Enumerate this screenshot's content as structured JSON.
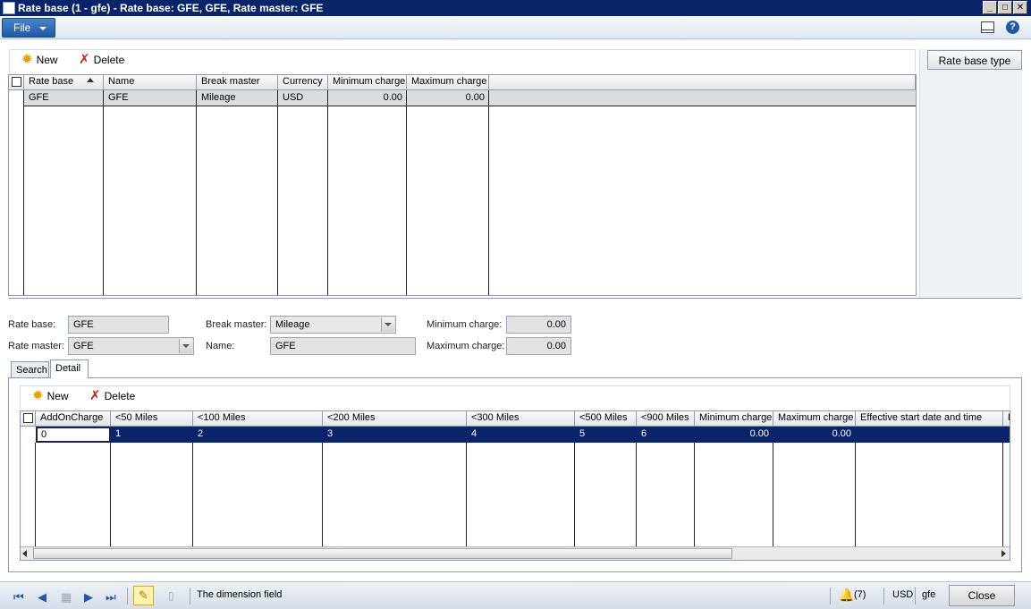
{
  "window": {
    "title": "Rate base (1 - gfe) - Rate base: GFE, GFE, Rate master: GFE",
    "controls": {
      "minimize": "_",
      "maximize": "□",
      "close": "✕"
    }
  },
  "menu": {
    "file_label": "File",
    "help_glyph": "?"
  },
  "top_toolbar": {
    "new_label": "New",
    "delete_label": "Delete",
    "side_button": "Rate base type"
  },
  "rate_grid": {
    "columns": [
      "Rate base",
      "Name",
      "Break master",
      "Currency",
      "Minimum charge",
      "Maximum charge"
    ],
    "rows": [
      {
        "rate_base": "GFE",
        "name": "GFE",
        "break_master": "Mileage",
        "currency": "USD",
        "min_charge": "0.00",
        "max_charge": "0.00"
      }
    ]
  },
  "form": {
    "rate_base_label": "Rate base:",
    "rate_base_value": "GFE",
    "rate_master_label": "Rate master:",
    "rate_master_value": "GFE",
    "break_master_label": "Break master:",
    "break_master_value": "Mileage",
    "name_label": "Name:",
    "name_value": "GFE",
    "min_charge_label": "Minimum charge:",
    "min_charge_value": "0.00",
    "max_charge_label": "Maximum charge:",
    "max_charge_value": "0.00"
  },
  "tabs": [
    "Search",
    "Detail"
  ],
  "detail_toolbar": {
    "new_label": "New",
    "delete_label": "Delete"
  },
  "detail_grid": {
    "columns": [
      "AddOnCharge",
      "<50 Miles",
      "<100 Miles",
      "<200 Miles",
      "<300 Miles",
      "<500 Miles",
      "<900 Miles",
      "Minimum charge",
      "Maximum charge",
      "Effective start date and time",
      "E"
    ],
    "row": [
      "0",
      "1",
      "2",
      "3",
      "4",
      "5",
      "6",
      "0.00",
      "0.00",
      ""
    ]
  },
  "status": {
    "message": "The dimension field",
    "notifications": "(7)",
    "currency": "USD",
    "company": "gfe",
    "close_label": "Close"
  }
}
